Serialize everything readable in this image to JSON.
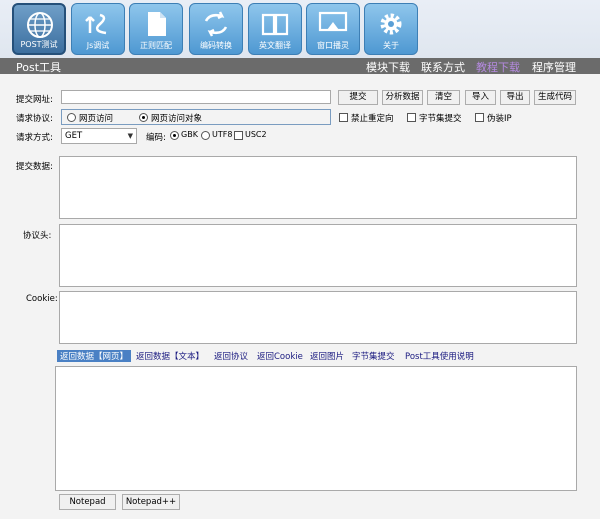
{
  "toolbar": {
    "items": [
      {
        "label": "POST测试",
        "icon": "globe-icon",
        "active": true
      },
      {
        "label": "Js调试",
        "icon": "js-icon"
      },
      {
        "label": "正则匹配",
        "icon": "document-icon"
      },
      {
        "label": "编码转换",
        "icon": "convert-icon"
      },
      {
        "label": "英文翻译",
        "icon": "book-icon"
      },
      {
        "label": "窗口播灵",
        "icon": "window-icon"
      },
      {
        "label": "关于",
        "icon": "gear-icon"
      }
    ]
  },
  "titlebar": {
    "title": "Post工具",
    "nav": [
      {
        "label": "模块下载"
      },
      {
        "label": "联系方式"
      },
      {
        "label": "教程下载",
        "current": true
      },
      {
        "label": "程序管理"
      }
    ]
  },
  "form": {
    "url_label": "提交网址:",
    "url_value": "",
    "buttons": {
      "submit": "提交",
      "analyze": "分析数据",
      "clear": "清空",
      "import": "导入",
      "export": "导出",
      "generate": "生成代码"
    },
    "protocol_label": "请求协议:",
    "protocol_options": [
      "网页访问",
      "网页访问对象"
    ],
    "protocol_selected": "网页访问对象",
    "no_redirect_label": "禁止重定向",
    "byte_submit_label": "字节集提交",
    "fake_ip_label": "伪装IP",
    "method_label": "请求方式:",
    "method_value": "GET",
    "encoding_label": "编码:",
    "encoding_options": [
      "GBK",
      "UTF8",
      "USC2"
    ],
    "encoding_selected": "GBK",
    "submit_data_label": "提交数据:",
    "headers_label": "协议头:",
    "cookie_label": "Cookie:"
  },
  "result_tabs": [
    {
      "label": "返回数据【网页】",
      "active": true
    },
    {
      "label": "返回数据【文本】"
    },
    {
      "label": "返回协议"
    },
    {
      "label": "返回Cookie"
    },
    {
      "label": "返回图片"
    },
    {
      "label": "字节集提交"
    },
    {
      "label": "Post工具使用说明"
    }
  ],
  "footer": {
    "notepad": "Notepad",
    "notepadpp": "Notepad++"
  }
}
